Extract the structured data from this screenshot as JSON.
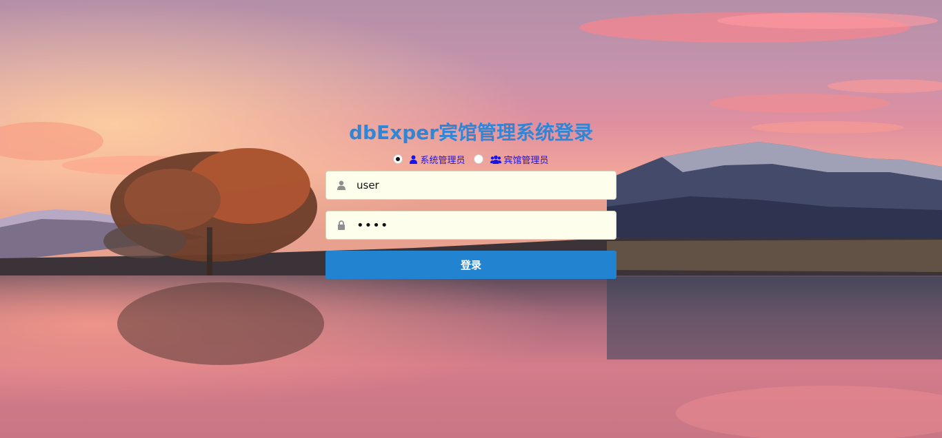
{
  "page": {
    "title": "dbExper宾馆管理系统登录"
  },
  "roles": [
    {
      "label": "系统管理员",
      "icon": "user-icon",
      "checked": true
    },
    {
      "label": "宾馆管理员",
      "icon": "users-icon",
      "checked": false
    }
  ],
  "form": {
    "username_value": "user",
    "username_icon": "user-icon",
    "password_value": "1234",
    "password_icon": "lock-icon",
    "submit_label": "登录"
  },
  "colors": {
    "title": "#2f86d6",
    "role_text": "#1b14e8",
    "button": "#2283d0",
    "input_bg": "#fefeec"
  }
}
